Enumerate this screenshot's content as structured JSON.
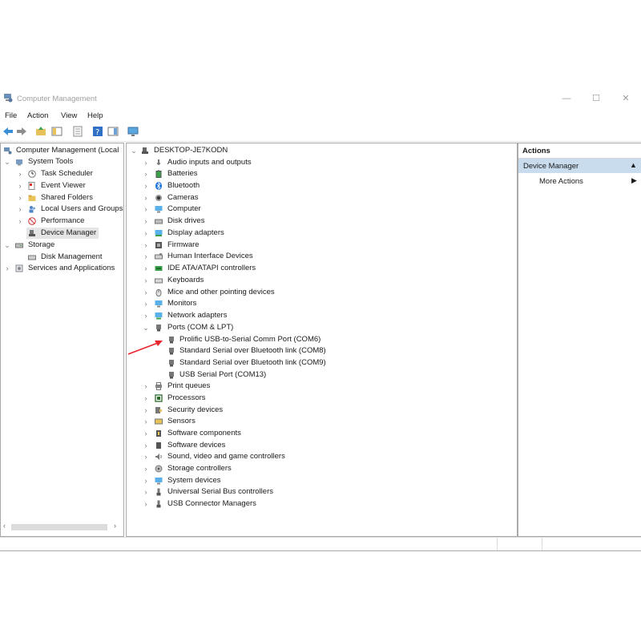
{
  "window": {
    "title": "Computer Management",
    "minimize": "—",
    "maximize": "☐",
    "close": "✕"
  },
  "menu": [
    "File",
    "Action",
    "View",
    "Help"
  ],
  "left_tree": {
    "root": "Computer Management (Local",
    "system_tools": "System Tools",
    "system_tools_items": [
      "Task Scheduler",
      "Event Viewer",
      "Shared Folders",
      "Local Users and Groups",
      "Performance",
      "Device Manager"
    ],
    "storage": "Storage",
    "storage_items": [
      "Disk Management"
    ],
    "services": "Services and Applications"
  },
  "device_tree": {
    "computer": "DESKTOP-JE7KODN",
    "categories_before": [
      "Audio inputs and outputs",
      "Batteries",
      "Bluetooth",
      "Cameras",
      "Computer",
      "Disk drives",
      "Display adapters",
      "Firmware",
      "Human Interface Devices",
      "IDE ATA/ATAPI controllers",
      "Keyboards",
      "Mice and other pointing devices",
      "Monitors",
      "Network adapters"
    ],
    "ports": "Ports (COM & LPT)",
    "port_devices": [
      "Prolific USB-to-Serial Comm Port (COM6)",
      "Standard Serial over Bluetooth link (COM8)",
      "Standard Serial over Bluetooth link (COM9)",
      "USB Serial Port (COM13)"
    ],
    "categories_after": [
      "Print queues",
      "Processors",
      "Security devices",
      "Sensors",
      "Software components",
      "Software devices",
      "Sound, video and game controllers",
      "Storage controllers",
      "System devices",
      "Universal Serial Bus controllers",
      "USB Connector Managers"
    ]
  },
  "actions": {
    "title": "Actions",
    "section": "Device Manager",
    "more": "More Actions"
  },
  "colors": {
    "selection": "#e5e5e5",
    "actions_header": "#c9dcee",
    "annotation_arrow": "#e8242c"
  }
}
